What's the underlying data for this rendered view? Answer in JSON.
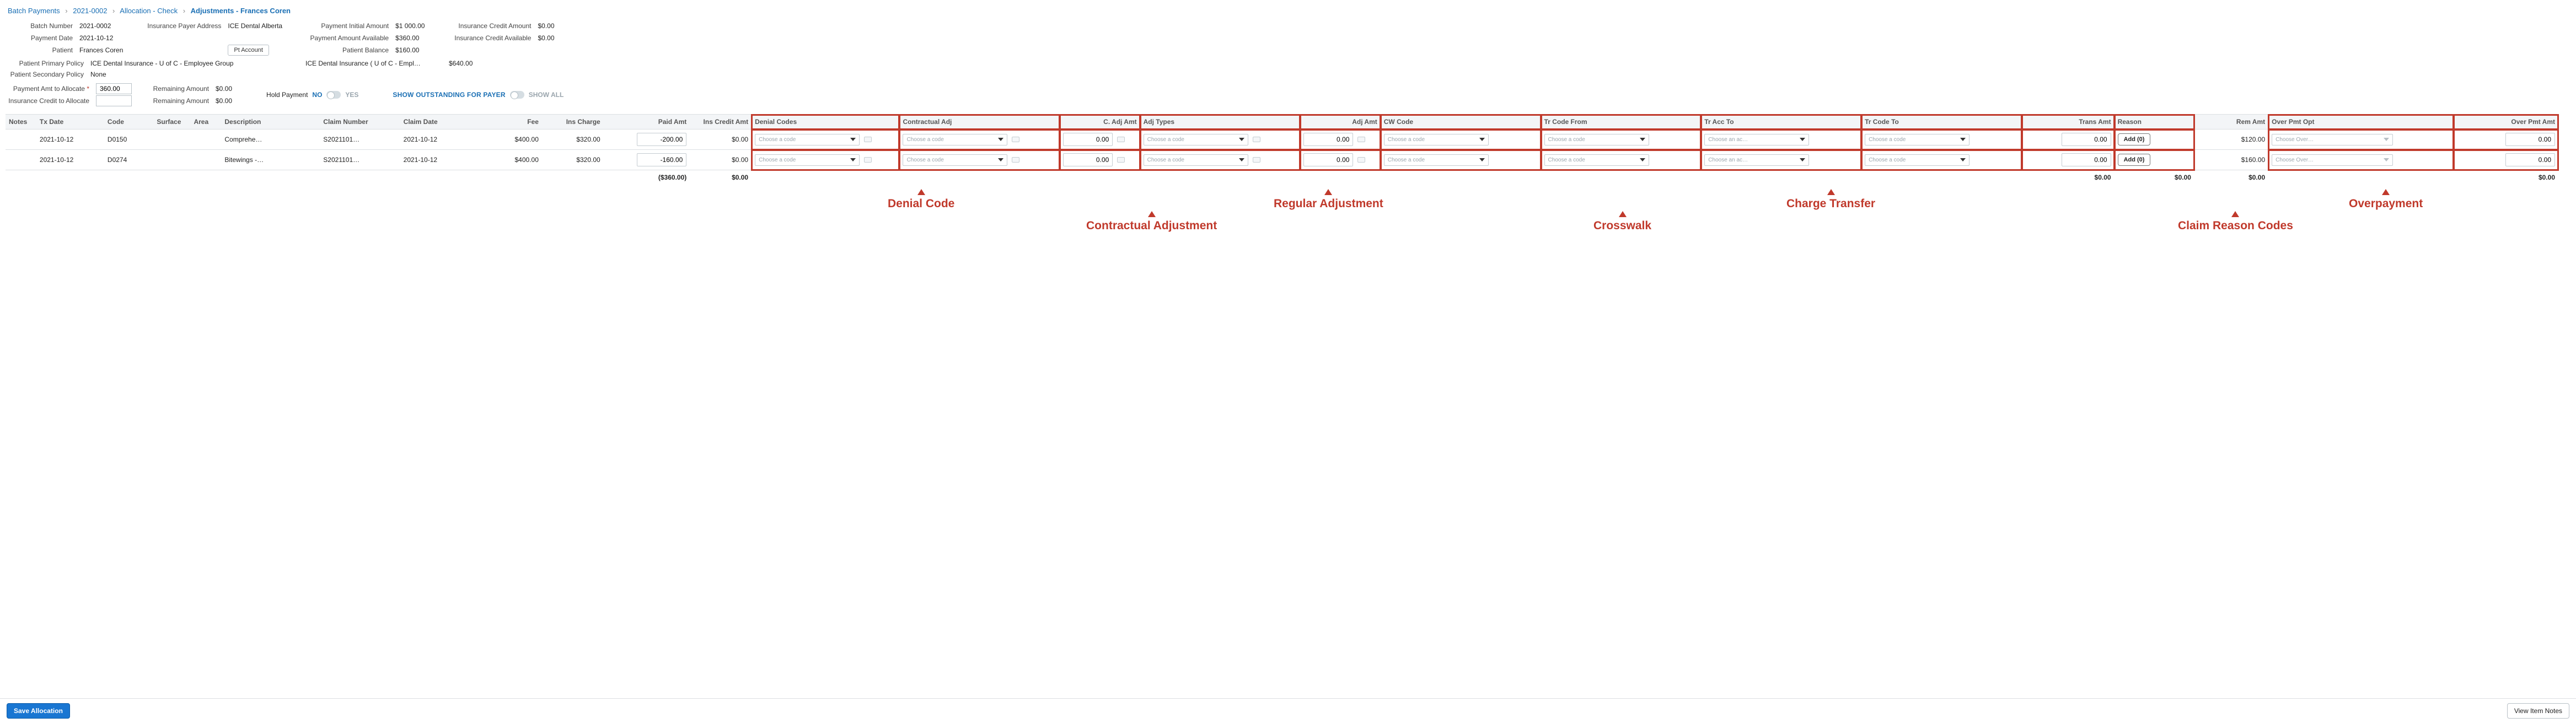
{
  "breadcrumbs": {
    "batch_payments": "Batch Payments",
    "batch_id": "2021-0002",
    "allocation": "Allocation - Check",
    "adjustments": "Adjustments - Frances Coren"
  },
  "meta": {
    "batch_number_label": "Batch Number",
    "batch_number": "2021-0002",
    "payment_date_label": "Payment Date",
    "payment_date": "2021-10-12",
    "patient_label": "Patient",
    "patient": "Frances Coren",
    "ins_payer_addr_label": "Insurance Payer Address",
    "ins_payer_addr": "ICE Dental Alberta",
    "pt_account_btn": "Pt Account",
    "payment_initial_label": "Payment Initial Amount",
    "payment_initial": "$1 000.00",
    "payment_avail_label": "Payment Amount Available",
    "payment_avail": "$360.00",
    "patient_balance_label": "Patient Balance",
    "patient_balance": "$160.00",
    "ins_credit_amt_label": "Insurance Credit Amount",
    "ins_credit_amt": "$0.00",
    "ins_credit_avail_label": "Insurance Credit Available",
    "ins_credit_avail": "$0.00",
    "primary_policy_label": "Patient Primary Policy",
    "primary_policy": "ICE Dental Insurance - U of C - Employee Group",
    "secondary_policy_label": "Patient Secondary Policy",
    "secondary_policy": "None",
    "policy_display": "ICE Dental Insurance ( U of C - Empl…",
    "policy_amount": "$640.00",
    "pay_amt_label": "Payment Amt to Allocate",
    "pay_amt_value": "360.00",
    "ins_credit_alloc_label": "Insurance Credit to Allocate",
    "ins_credit_alloc_value": "",
    "remaining_label": "Remaining Amount",
    "remaining_1": "$0.00",
    "remaining_2": "$0.00",
    "hold_label": "Hold Payment",
    "no": "NO",
    "yes": "YES",
    "show_outstanding": "SHOW OUTSTANDING FOR PAYER",
    "show_all": "SHOW ALL"
  },
  "columns": {
    "notes": "Notes",
    "tx_date": "Tx Date",
    "code": "Code",
    "surface": "Surface",
    "area": "Area",
    "description": "Description",
    "claim_number": "Claim Number",
    "claim_date": "Claim Date",
    "fee": "Fee",
    "ins_charge": "Ins Charge",
    "paid_amt": "Paid Amt",
    "ins_credit_amt": "Ins Credit Amt",
    "denial": "Denial Codes",
    "contractual_adj": "Contractual Adj",
    "c_adj_amt": "C. Adj Amt",
    "adj_types": "Adj Types",
    "adj_amt": "Adj Amt",
    "cw_code": "CW Code",
    "tr_code_from": "Tr Code From",
    "tr_acc_to": "Tr Acc To",
    "tr_code_to": "Tr Code To",
    "trans_amt": "Trans Amt",
    "reason": "Reason",
    "rem_amt": "Rem Amt",
    "over_opt": "Over Pmt Opt",
    "over_amt": "Over Pmt Amt"
  },
  "placeholders": {
    "choose_code": "Choose a code",
    "choose_acc": "Choose an ac…",
    "choose_over": "Choose Over…"
  },
  "rows": [
    {
      "tx_date": "2021-10-12",
      "code": "D0150",
      "description": "Comprehe…",
      "claim_number": "S2021101…",
      "claim_date": "2021-10-12",
      "fee": "$400.00",
      "ins_charge": "$320.00",
      "paid_amt": "-200.00",
      "ins_credit_amt": "$0.00",
      "c_adj_amt": "0.00",
      "adj_amt": "0.00",
      "trans_amt": "0.00",
      "reason_btn": "Add (0)",
      "rem_amt": "$120.00",
      "over_amt": "0.00"
    },
    {
      "tx_date": "2021-10-12",
      "code": "D0274",
      "description": "Bitewings -…",
      "claim_number": "S2021101…",
      "claim_date": "2021-10-12",
      "fee": "$400.00",
      "ins_charge": "$320.00",
      "paid_amt": "-160.00",
      "ins_credit_amt": "$0.00",
      "c_adj_amt": "0.00",
      "adj_amt": "0.00",
      "trans_amt": "0.00",
      "reason_btn": "Add (0)",
      "rem_amt": "$160.00",
      "over_amt": "0.00"
    }
  ],
  "totals": {
    "paid": "($360.00)",
    "ins_credit": "$0.00",
    "trans": "$0.00",
    "reason": "$0.00",
    "rem": "$0.00",
    "over": "$0.00"
  },
  "annotations": {
    "denial": "Denial Code",
    "contractual": "Contractual Adjustment",
    "regular": "Regular Adjustment",
    "crosswalk": "Crosswalk",
    "charge_transfer": "Charge Transfer",
    "claim_reason": "Claim Reason Codes",
    "overpayment": "Overpayment"
  },
  "footer": {
    "save": "Save Allocation",
    "view_notes": "View Item Notes"
  }
}
